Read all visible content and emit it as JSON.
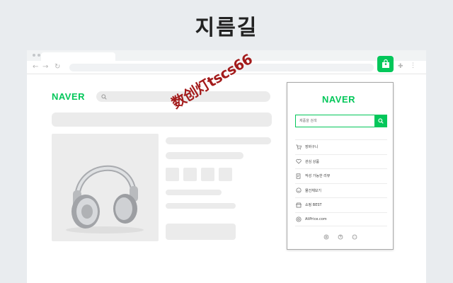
{
  "hero": {
    "title": "지름길"
  },
  "page": {
    "logo": "NAVER"
  },
  "popup": {
    "logo": "NAVER",
    "search_placeholder": "제품을 검색",
    "menu": [
      {
        "label": "장바구니",
        "icon": "cart-icon"
      },
      {
        "label": "관심 상품",
        "icon": "heart-icon"
      },
      {
        "label": "작성 가능한 리뷰",
        "icon": "review-icon"
      },
      {
        "label": "물건체보기",
        "icon": "smile-icon"
      },
      {
        "label": "쇼핑 BEST",
        "icon": "shop-icon"
      },
      {
        "label": "AliPrice.com",
        "icon": "aliprice-icon"
      }
    ],
    "footer_icons": [
      "settings-icon",
      "help-icon",
      "feedback-icon"
    ]
  },
  "overlay": {
    "watermark": "数创灯tscs66"
  },
  "colors": {
    "brand": "#03c75a",
    "watermark": "#a31b1b",
    "page_bg": "#e9ecef"
  }
}
